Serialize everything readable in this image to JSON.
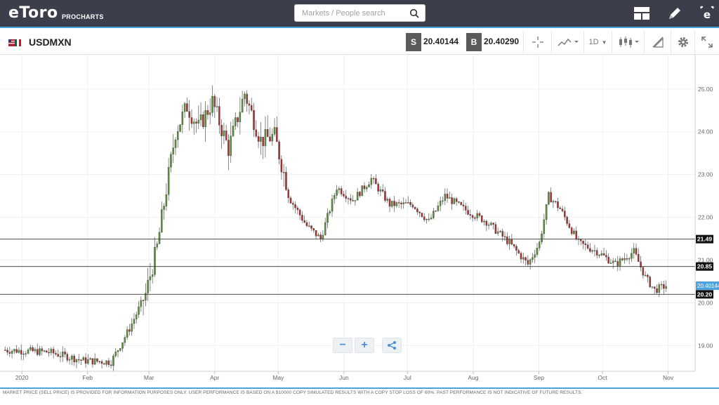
{
  "header": {
    "logo_text": "eToro",
    "logo_sub": "PROCHARTS",
    "search_placeholder": "Markets / People search",
    "icons": [
      "layout-icon",
      "pencil-icon",
      "etoro-e-icon"
    ]
  },
  "instrument": {
    "symbol": "USDMXN",
    "sell_label": "S",
    "sell_price": "20.40144",
    "buy_label": "B",
    "buy_price": "20.40290",
    "timeframe": "1D"
  },
  "colors": {
    "up": "#5a8f3c",
    "down": "#a83232",
    "accent": "#4aa3df",
    "topbar": "#3c3e4c"
  },
  "chart_data": {
    "type": "candlestick",
    "x_tick_labels": [
      "2020",
      "Feb",
      "Mar",
      "Apr",
      "May",
      "Jun",
      "Jul",
      "Aug",
      "Sep",
      "Oct",
      "Nov"
    ],
    "y_tick_labels": [
      "19.00",
      "20.00",
      "21.00",
      "22.00",
      "23.00",
      "24.00",
      "25.00"
    ],
    "ylim": [
      18.4,
      25.8
    ],
    "horizontal_lines": [
      {
        "value": 21.49,
        "label": "21.49"
      },
      {
        "value": 20.85,
        "label": "20.85"
      },
      {
        "value": 20.2,
        "label": "20.20"
      }
    ],
    "current_price": {
      "value": 20.40144,
      "label": "20.40144"
    },
    "key_points": [
      {
        "day": 0,
        "close": 18.9
      },
      {
        "day": 20,
        "close": 18.85
      },
      {
        "day": 35,
        "close": 18.65
      },
      {
        "day": 47,
        "close": 18.62
      },
      {
        "day": 55,
        "close": 19.4
      },
      {
        "day": 62,
        "close": 20.2
      },
      {
        "day": 67,
        "close": 21.3
      },
      {
        "day": 75,
        "close": 24.0
      },
      {
        "day": 80,
        "close": 24.6
      },
      {
        "day": 85,
        "close": 24.1
      },
      {
        "day": 91,
        "close": 24.7
      },
      {
        "day": 98,
        "close": 23.6
      },
      {
        "day": 105,
        "close": 24.9
      },
      {
        "day": 112,
        "close": 23.8
      },
      {
        "day": 118,
        "close": 23.9
      },
      {
        "day": 125,
        "close": 22.4
      },
      {
        "day": 132,
        "close": 21.8
      },
      {
        "day": 138,
        "close": 21.5
      },
      {
        "day": 145,
        "close": 22.7
      },
      {
        "day": 152,
        "close": 22.4
      },
      {
        "day": 160,
        "close": 22.9
      },
      {
        "day": 168,
        "close": 22.3
      },
      {
        "day": 178,
        "close": 22.3
      },
      {
        "day": 185,
        "close": 21.9
      },
      {
        "day": 192,
        "close": 22.5
      },
      {
        "day": 200,
        "close": 22.2
      },
      {
        "day": 210,
        "close": 21.9
      },
      {
        "day": 220,
        "close": 21.4
      },
      {
        "day": 228,
        "close": 20.9
      },
      {
        "day": 233,
        "close": 21.4
      },
      {
        "day": 237,
        "close": 22.5
      },
      {
        "day": 242,
        "close": 22.2
      },
      {
        "day": 250,
        "close": 21.4
      },
      {
        "day": 258,
        "close": 21.2
      },
      {
        "day": 266,
        "close": 20.9
      },
      {
        "day": 274,
        "close": 21.2
      },
      {
        "day": 279,
        "close": 20.6
      },
      {
        "day": 283,
        "close": 20.3
      },
      {
        "day": 288,
        "close": 20.4
      }
    ]
  },
  "footer": {
    "disclaimer": "MARKET PRICE (SELL PRICE) IS PROVIDED FOR INFORMATION PURPOSES ONLY. USER PERFORMANCE IS BASED ON A $10000 COPY SIMULATED RESULTS WITH A COPY STOP LOSS OF 60%. PAST PERFORMANCE IS NOT INDICATIVE OF FUTURE RESULTS."
  },
  "controls": {
    "zoom_out": "−",
    "zoom_in": "+"
  }
}
